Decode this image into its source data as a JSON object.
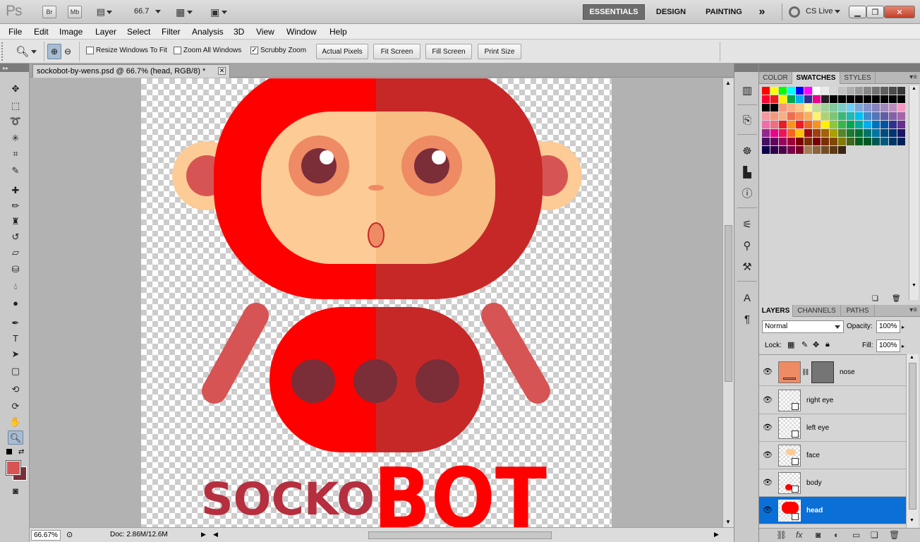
{
  "app": {
    "logo": "Ps",
    "bridge_label": "Br",
    "minibridge_label": "Mb",
    "zoom_value": "66.7",
    "workspaces": [
      "ESSENTIALS",
      "DESIGN",
      "PAINTING"
    ],
    "more_workspaces": "»",
    "cs_live": "CS Live"
  },
  "menu": [
    "File",
    "Edit",
    "Image",
    "Layer",
    "Select",
    "Filter",
    "Analysis",
    "3D",
    "View",
    "Window",
    "Help"
  ],
  "options": {
    "resize_windows": "Resize Windows To Fit",
    "zoom_all_windows": "Zoom All Windows",
    "scrubby_zoom": "Scrubby Zoom",
    "actual_pixels": "Actual Pixels",
    "fit_screen": "Fit Screen",
    "fill_screen": "Fill Screen",
    "print_size": "Print Size"
  },
  "document": {
    "tab_title": "sockobot-by-wens.psd @ 66.7% (head, RGB/8) *",
    "zoom_status": "66.67%",
    "doc_info": "Doc: 2.86M/12.6M",
    "artwork": {
      "text_socko": "SOCKO",
      "text_bot": "BOT",
      "colors": {
        "red": "#ff0000",
        "dark_red": "#c62828",
        "face_light": "#fdcb96",
        "face_dark": "#f7bd82",
        "ear": "#fdcb96",
        "ear_inner": "#d75454",
        "eye_ring": "#ee8a64",
        "pupil": "#7b2d38",
        "arm": "#d75454",
        "button": "#7b2d38",
        "socko_text": "#b52f3e"
      }
    }
  },
  "panels": {
    "swatch_tabs": [
      "COLOR",
      "SWATCHES",
      "STYLES"
    ],
    "active_swatch_tab": "SWATCHES",
    "layer_tabs": [
      "LAYERS",
      "CHANNELS",
      "PATHS"
    ],
    "blend_mode": "Normal",
    "opacity_label": "Opacity:",
    "opacity_value": "100%",
    "lock_label": "Lock:",
    "fill_label": "Fill:",
    "fill_value": "100%",
    "layers": [
      {
        "name": "nose",
        "selected": false
      },
      {
        "name": "right eye",
        "selected": false
      },
      {
        "name": "left eye",
        "selected": false
      },
      {
        "name": "face",
        "selected": false
      },
      {
        "name": "body",
        "selected": false
      },
      {
        "name": "head",
        "selected": true
      }
    ]
  },
  "swatches": [
    "#ff0000",
    "#ffff00",
    "#00ff00",
    "#00ffff",
    "#0000ff",
    "#ff00ff",
    "#ffffff",
    "#ebebeb",
    "#d7d7d7",
    "#c3c3c3",
    "#afafaf",
    "#9b9b9b",
    "#878787",
    "#737373",
    "#5f5f5f",
    "#4b4b4b",
    "#373737",
    "#ff0033",
    "#ed1c24",
    "#fff200",
    "#00a651",
    "#00aeef",
    "#2e3192",
    "#ec008c",
    "#231f20",
    "#000000",
    "#000000",
    "#000000",
    "#000000",
    "#000000",
    "#000000",
    "#000000",
    "#000000",
    "#000000",
    "#000000",
    "#000000",
    "#f7977a",
    "#f9ad81",
    "#fdc68a",
    "#fff79a",
    "#c4df9b",
    "#a2d39c",
    "#82ca9d",
    "#7bcdc8",
    "#6ecff6",
    "#7ea7d8",
    "#8493ca",
    "#8882be",
    "#a187be",
    "#bc8dbf",
    "#f49ac2",
    "#f6989d",
    "#f7977a",
    "#f9ad81",
    "#f26c4f",
    "#f68e55",
    "#fbaf5c",
    "#fff467",
    "#acd372",
    "#7cc576",
    "#3bb878",
    "#1abbb4",
    "#00bff3",
    "#438cca",
    "#5574b9",
    "#605ca8",
    "#855fa8",
    "#a763a8",
    "#f06ea9",
    "#f26d7d",
    "#ed1c24",
    "#f7941d",
    "#ed1c24",
    "#f26522",
    "#f7941d",
    "#fff200",
    "#8dc73f",
    "#39b54a",
    "#00a651",
    "#00a99d",
    "#00aeef",
    "#0072bc",
    "#0054a6",
    "#2e3192",
    "#662d91",
    "#92278f",
    "#ec008c",
    "#ed145b",
    "#f26522",
    "#ffc20e",
    "#9e0b0f",
    "#a0410d",
    "#a36209",
    "#aba000",
    "#598527",
    "#1a7b30",
    "#007236",
    "#00746b",
    "#0076a3",
    "#004b80",
    "#003471",
    "#1b1464",
    "#440e62",
    "#630460",
    "#9e005d",
    "#9e0039",
    "#790000",
    "#7b2e00",
    "#790000",
    "#7b2e00",
    "#7d4900",
    "#827b00",
    "#406618",
    "#005e20",
    "#005826",
    "#005952",
    "#005b7f",
    "#003663",
    "#002157",
    "#0d004c",
    "#32004b",
    "#4b0049",
    "#7b0046",
    "#7a0026",
    "#a67c52",
    "#8c6239",
    "#754c24",
    "#603913",
    "#3c2415"
  ]
}
